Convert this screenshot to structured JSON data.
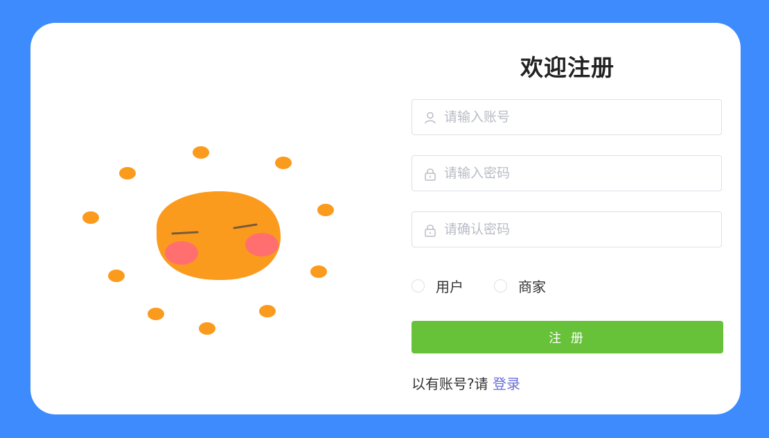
{
  "form": {
    "title": "欢迎注册",
    "account_placeholder": "请输入账号",
    "password_placeholder": "请输入密码",
    "confirm_placeholder": "请确认密码",
    "role_options": [
      "用户",
      "商家"
    ],
    "submit_label": "注 册",
    "login_prompt": "以有账号?请 ",
    "login_link": "登录"
  },
  "icons": {
    "account": "user-icon",
    "password": "lock-icon",
    "confirm": "lock-icon"
  },
  "colors": {
    "background": "#3d8bfd",
    "submit": "#67c23a",
    "link": "#6a6fd8",
    "sun": "#fb9b1e",
    "blush": "#ff6f6f"
  }
}
